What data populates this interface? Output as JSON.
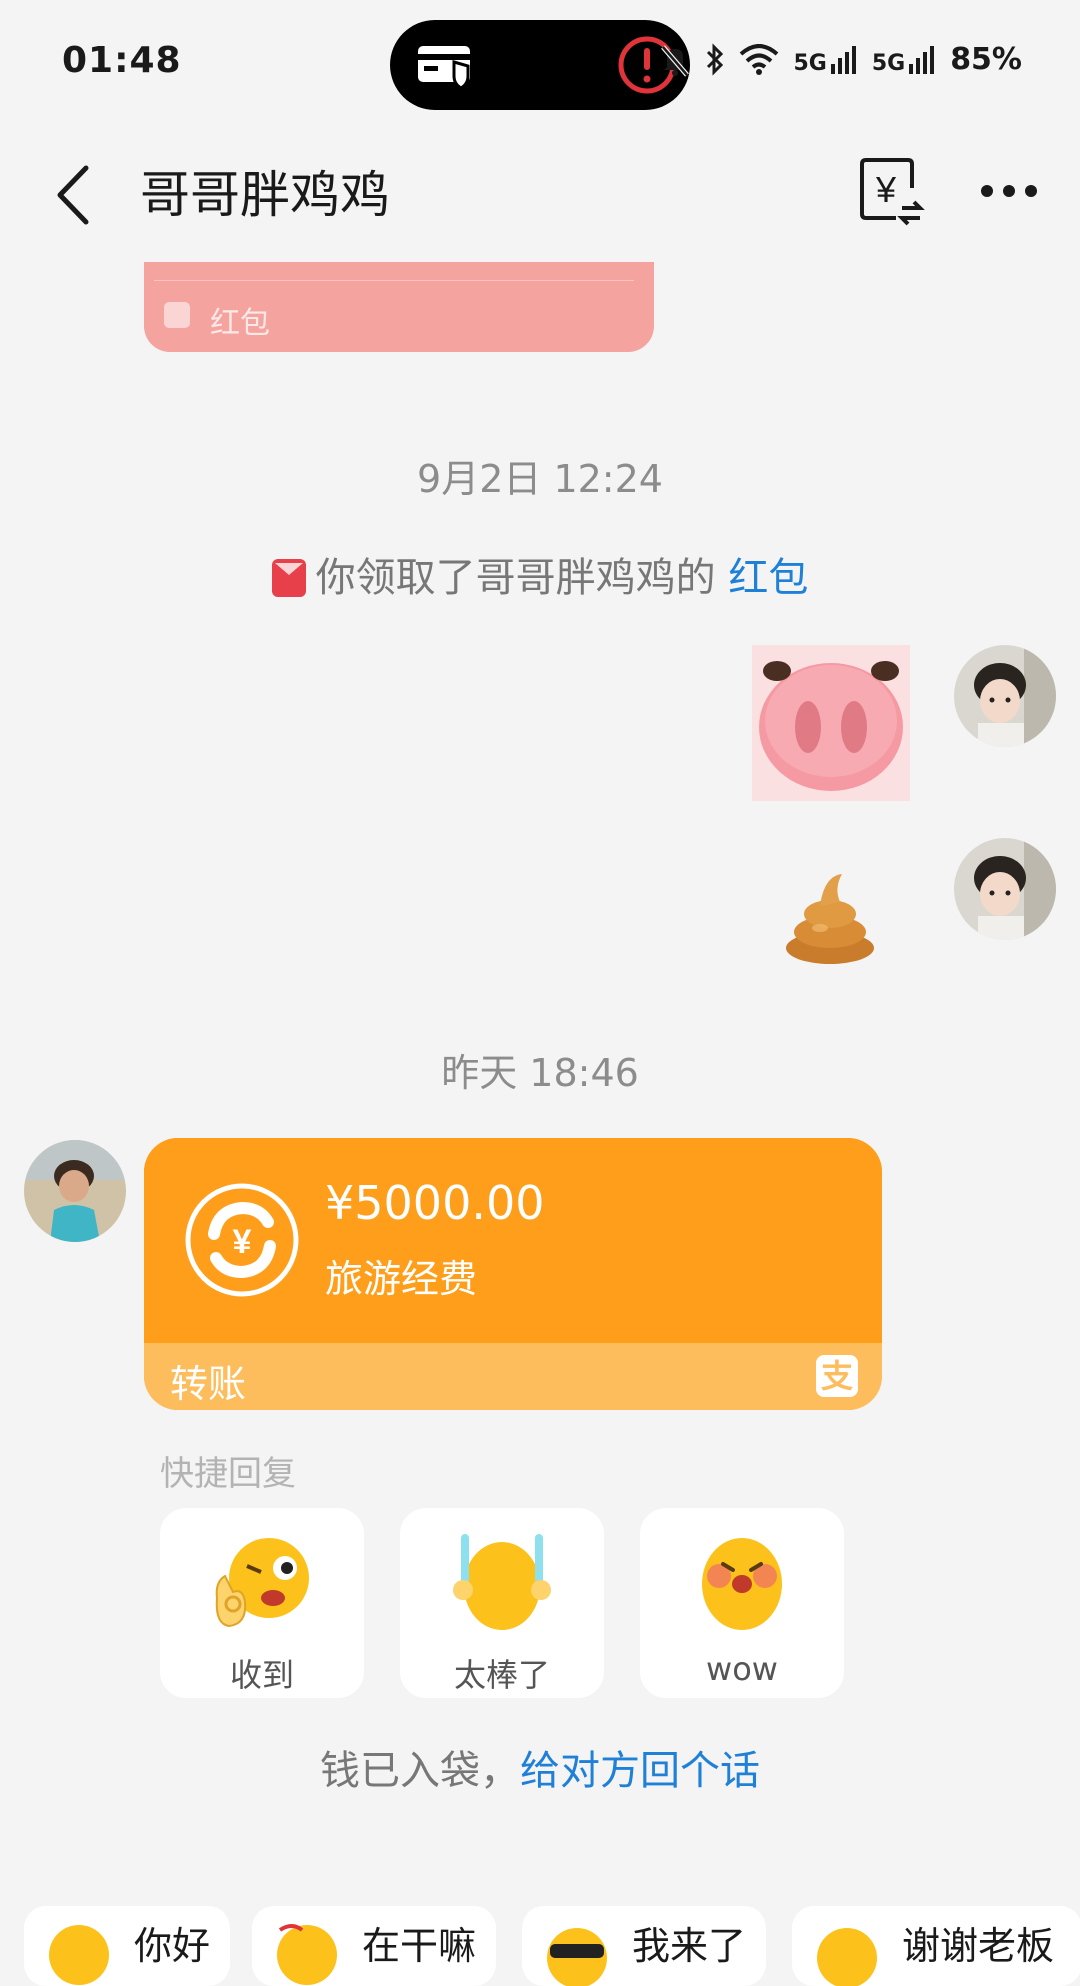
{
  "status_bar": {
    "time": "01:48",
    "signal_1": "5G",
    "signal_2": "5G",
    "battery": "85%",
    "icons": [
      "card-shield-icon",
      "alert-icon",
      "mute-icon",
      "bluetooth-icon",
      "wifi-icon",
      "signal-icon",
      "signal-icon"
    ]
  },
  "header": {
    "title": "哥哥胖鸡鸡",
    "icons": [
      "back-icon",
      "transfer-icon",
      "more-icon"
    ]
  },
  "messages": {
    "red_packet_label": "红包",
    "timestamp_1": "9月2日 12:24",
    "system_text": "你领取了哥哥胖鸡鸡的 ",
    "system_link": "红包",
    "timestamp_2": "昨天 18:46",
    "transfer": {
      "amount": "¥5000.00",
      "note": "旅游经费",
      "label": "转账",
      "logo": "支"
    }
  },
  "quick_reply": {
    "title": "快捷回复",
    "items": [
      {
        "label": "收到",
        "icon": "ok-hand-emoji-icon"
      },
      {
        "label": "太棒了",
        "icon": "applause-emoji-icon"
      },
      {
        "label": "wow",
        "icon": "wow-emoji-icon"
      }
    ]
  },
  "reply_prompt": {
    "text": "钱已入袋，",
    "link": "给对方回个话"
  },
  "chips": [
    {
      "label": "你好"
    },
    {
      "label": "在干嘛"
    },
    {
      "label": "我来了"
    },
    {
      "label": "谢谢老板"
    }
  ],
  "colors": {
    "background": "#f4f4f4",
    "transfer_orange": "#ff9e1b",
    "transfer_footer": "#fdbd5c",
    "link_blue": "#1f80d8",
    "red_packet": "#f4a39f"
  }
}
